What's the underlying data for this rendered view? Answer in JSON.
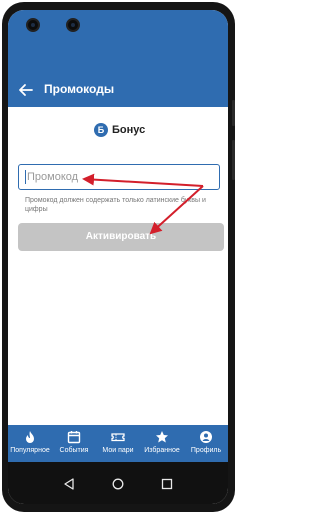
{
  "appbar": {
    "title": "Промокоды",
    "back_icon": "arrow-left-icon"
  },
  "bonus": {
    "badge": "Б",
    "label": "Бонус"
  },
  "promo": {
    "placeholder": "Промокод",
    "hint": "Промокод должен содержать только латинские буквы и цифры",
    "button_label": "Активировать"
  },
  "tabs": [
    {
      "label": "Популярное",
      "icon": "flame-icon"
    },
    {
      "label": "События",
      "icon": "calendar-icon"
    },
    {
      "label": "Мои пари",
      "icon": "ticket-icon"
    },
    {
      "label": "Избранное",
      "icon": "star-icon"
    },
    {
      "label": "Профиль",
      "icon": "profile-icon"
    }
  ],
  "colors": {
    "brand": "#2f6cb0",
    "arrow": "#d31f2b",
    "button_disabled": "#c4c4c4"
  }
}
